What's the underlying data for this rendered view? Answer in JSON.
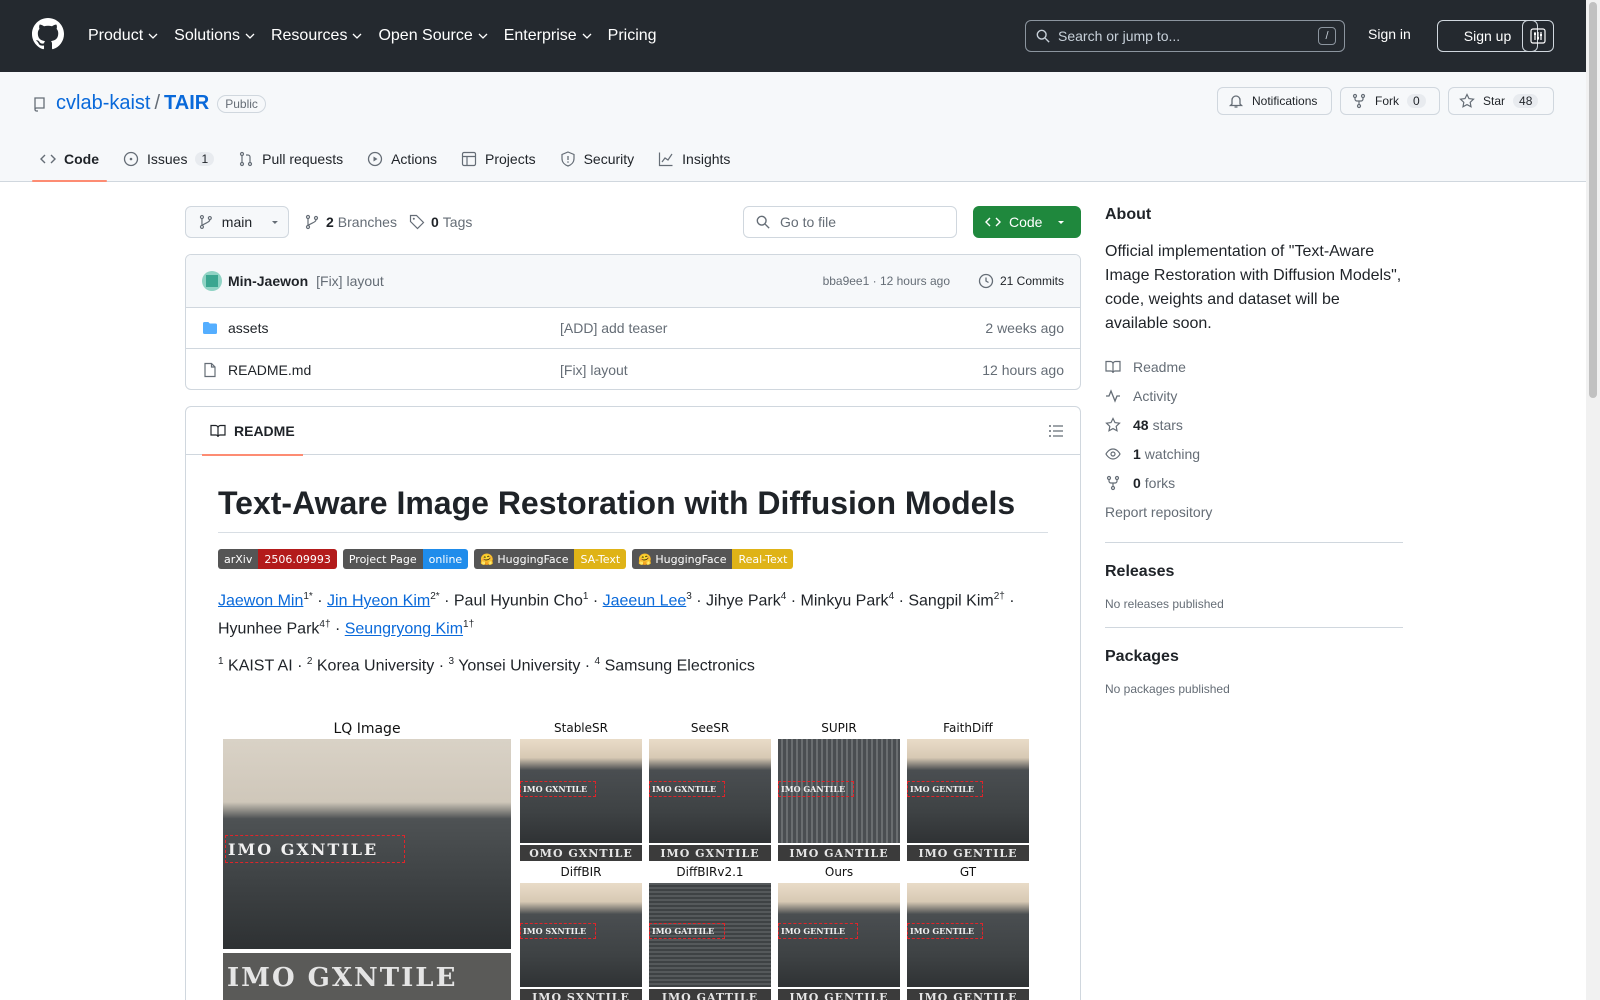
{
  "header": {
    "nav": [
      "Product",
      "Solutions",
      "Resources",
      "Open Source",
      "Enterprise",
      "Pricing"
    ],
    "search_placeholder": "Search or jump to...",
    "search_shortcut": "/",
    "signin": "Sign in",
    "signup": "Sign up"
  },
  "repo": {
    "owner": "cvlab-kaist",
    "separator": "/",
    "name": "TAIR",
    "visibility": "Public",
    "notifications_label": "Notifications",
    "fork_label": "Fork",
    "fork_count": "0",
    "star_label": "Star",
    "star_count": "48"
  },
  "tabs": [
    {
      "label": "Code"
    },
    {
      "label": "Issues",
      "count": "1"
    },
    {
      "label": "Pull requests"
    },
    {
      "label": "Actions"
    },
    {
      "label": "Projects"
    },
    {
      "label": "Security"
    },
    {
      "label": "Insights"
    }
  ],
  "toolbar": {
    "branch": "main",
    "branches_count": "2",
    "branches_label": "Branches",
    "tags_count": "0",
    "tags_label": "Tags",
    "goto_placeholder": "Go to file",
    "code_label": "Code"
  },
  "commit": {
    "author": "Min-Jaewon",
    "message": "[Fix] layout",
    "meta": "bba9ee1 · 12 hours ago",
    "commits": "21 Commits"
  },
  "files": [
    {
      "name": "assets",
      "type": "folder",
      "message": "[ADD] add teaser",
      "date": "2 weeks ago"
    },
    {
      "name": "README.md",
      "type": "file",
      "message": "[Fix] layout",
      "date": "12 hours ago"
    }
  ],
  "readme": {
    "tab_label": "README",
    "title": "Text-Aware Image Restoration with Diffusion Models",
    "badges": [
      {
        "left": "arXiv",
        "right": "2506.09993",
        "color": "#b31b1b"
      },
      {
        "left": "Project Page",
        "right": "online",
        "color": "#1f8ceb"
      },
      {
        "left": "🤗 HuggingFace",
        "right": "SA-Text",
        "color": "#dfb317"
      },
      {
        "left": "🤗 HuggingFace",
        "right": "Real-Text",
        "color": "#dfb317"
      }
    ],
    "authors": {
      "a1": "Jaewon Min",
      "a1s": "1*",
      "a2": "Jin Hyeon Kim",
      "a2s": "2*",
      "a3": "Paul Hyunbin Cho",
      "a3s": "1",
      "a4": "Jaeeun Lee",
      "a4s": "3",
      "a5": "Jihye Park",
      "a5s": "4",
      "a6": "Minkyu Park",
      "a6s": "4",
      "a7": "Sangpil Kim",
      "a7s": "2†",
      "a8": "Hyunhee Park",
      "a8s": "4†",
      "a9": "Seungryong Kim",
      "a9s": "1†",
      "dot": " · "
    },
    "affiliations": {
      "n1": "1",
      "t1": "KAIST AI",
      "n2": "2",
      "t2": "Korea University",
      "n3": "3",
      "t3": "Yonsei University",
      "n4": "4",
      "t4": "Samsung Electronics"
    },
    "teaser": {
      "lq_label": "LQ Image",
      "lq_box_text": "IMO GXNTILE",
      "lq_strip_text": "IMO GXNTILE",
      "methods": [
        {
          "label": "StableSR",
          "box": "IMO GXNTILE",
          "strip": "OMO GXNTILE"
        },
        {
          "label": "SeeSR",
          "box": "IMO GXNTILE",
          "strip": "IMO GXNTILE"
        },
        {
          "label": "SUPIR",
          "box": "IMO GANTILE",
          "strip": "IMO GANTILE"
        },
        {
          "label": "FaithDiff",
          "box": "IMO GENTILE",
          "strip": "IMO GENTILE"
        },
        {
          "label": "DiffBIR",
          "box": "IMO SXNTILE",
          "strip": "IMO SXNTILE"
        },
        {
          "label": "DiffBIRv2.1",
          "box": "IMO GATTILE",
          "strip": "IMO GATTILE"
        },
        {
          "label": "Ours",
          "box": "IMO GENTILE",
          "strip": "IMO GENTILE"
        },
        {
          "label": "GT",
          "box": "IMO GENTILE",
          "strip": "IMO GENTILE"
        }
      ]
    }
  },
  "sidebar": {
    "about_title": "About",
    "description": "Official implementation of \"Text-Aware Image Restoration with Diffusion Models\", code, weights and dataset will be available soon.",
    "readme": "Readme",
    "activity": "Activity",
    "stars_count": "48",
    "stars_label": "stars",
    "watching_count": "1",
    "watching_label": "watching",
    "forks_count": "0",
    "forks_label": "forks",
    "report": "Report repository",
    "releases_title": "Releases",
    "releases_empty": "No releases published",
    "packages_title": "Packages",
    "packages_empty": "No packages published"
  }
}
